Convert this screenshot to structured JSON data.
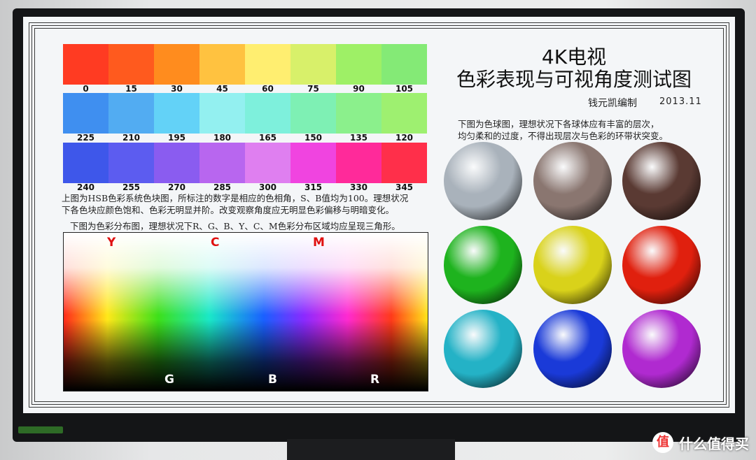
{
  "rows": [
    {
      "colors": [
        "#ff3b22",
        "#ff5a1e",
        "#ff8c1e",
        "#ffc240",
        "#ffee70",
        "#d8f06a",
        "#9ef066",
        "#84ea76"
      ],
      "labels": [
        "0",
        "15",
        "30",
        "45",
        "60",
        "75",
        "90",
        "105"
      ]
    },
    {
      "colors": [
        "#3f8ff0",
        "#52acf2",
        "#63d2f7",
        "#93f0f0",
        "#7ef0dc",
        "#7ef0b4",
        "#8bf08c",
        "#9ef070"
      ],
      "labels": [
        "225",
        "210",
        "195",
        "180",
        "165",
        "150",
        "135",
        "120"
      ]
    },
    {
      "colors": [
        "#3e57ea",
        "#5c5cf0",
        "#8a5cf0",
        "#b866ef",
        "#df7ff0",
        "#f044e0",
        "#ff2a9a",
        "#ff2f4a"
      ],
      "labels": [
        "240",
        "255",
        "270",
        "285",
        "300",
        "315",
        "330",
        "345"
      ]
    }
  ],
  "text": {
    "hsb_desc_1": "上图为HSB色彩系统色块图，所标注的数字是相应的色相角，S、B值均为100。理想状况",
    "hsb_desc_2": "下各色块应颜色饱和、色彩无明显并阶。改变观察角度应无明显色彩偏移与明暗变化。",
    "gamut_desc": "下图为色彩分布图，理想状况下R、G、B、Y、C、M色彩分布区域均应呈现三角形。",
    "title_line1": "4K电视",
    "title_line2": "色彩表现与可视角度测试图",
    "author": "钱元凯编制",
    "date": "2013.11",
    "sphere_desc_1": "下图为色球图，理想状况下各球体应有丰富的层次，",
    "sphere_desc_2": "均匀柔和的过度，不得出现层次与色彩的环带状突变。",
    "watermark": "什么值得买",
    "watermark_logo": "值"
  },
  "gamut_labels": {
    "top": [
      "Y",
      "C",
      "M"
    ],
    "bottom": [
      "G",
      "B",
      "R"
    ]
  },
  "spheres": [
    "#a9b2bb",
    "#8a7670",
    "#5a3a33",
    "#1eb31e",
    "#d9d21a",
    "#e0200e",
    "#24b2c6",
    "#1a3ad8",
    "#b02ad0"
  ]
}
